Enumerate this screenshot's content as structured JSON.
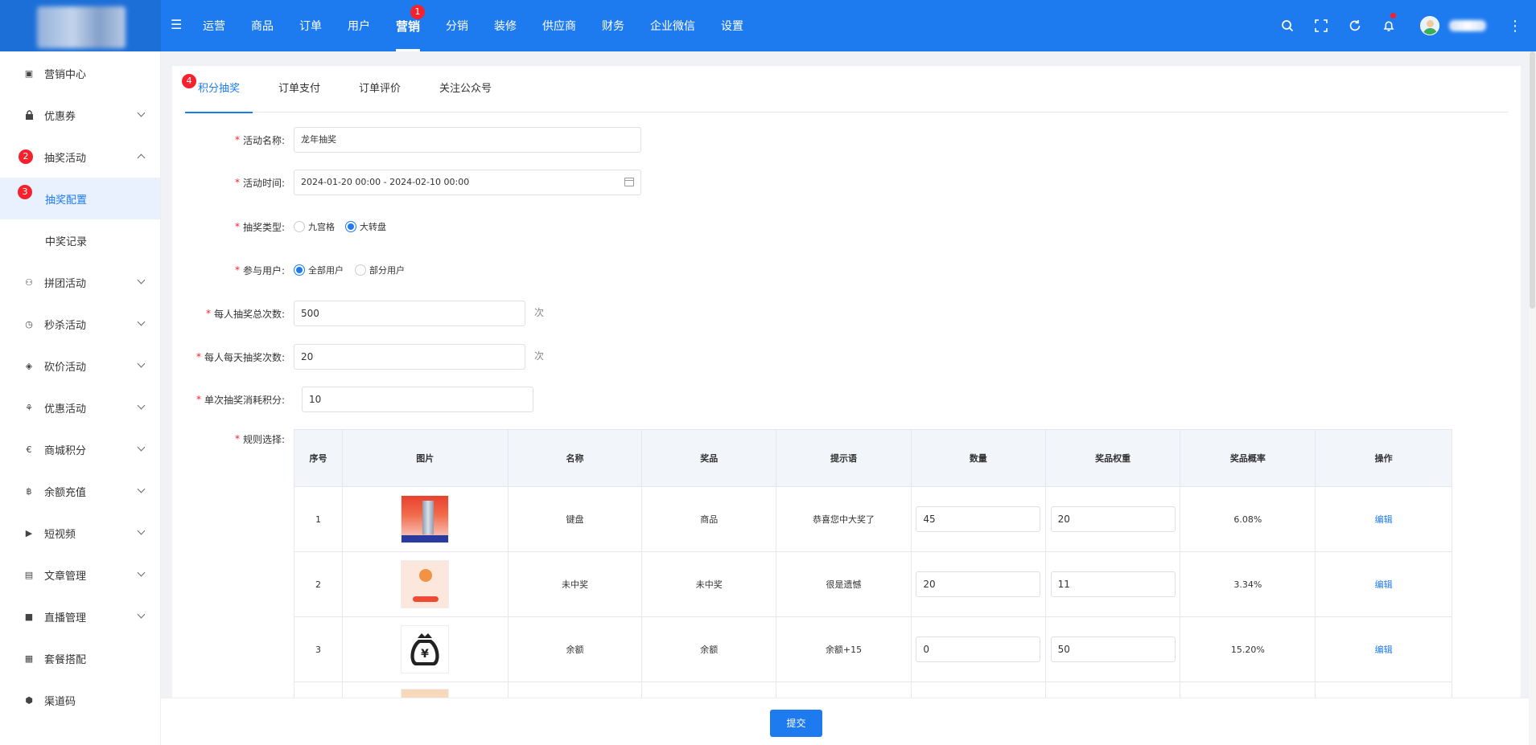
{
  "header": {
    "nav": [
      "运营",
      "商品",
      "订单",
      "用户",
      "营销",
      "分销",
      "装修",
      "供应商",
      "财务",
      "企业微信",
      "设置"
    ],
    "active_nav_badge": "1"
  },
  "sidebar": {
    "items": [
      {
        "label": "营销中心",
        "icon": "marketing-center-icon",
        "glyph": "▣"
      },
      {
        "label": "优惠券",
        "icon": "lock-icon",
        "glyph": "🔒"
      },
      {
        "label": "抽奖活动",
        "icon": "lottery-icon",
        "glyph": "◉",
        "badge": "2"
      },
      {
        "label": "拼团活动",
        "icon": "group-buy-icon",
        "glyph": "⚇"
      },
      {
        "label": "秒杀活动",
        "icon": "clock-icon",
        "glyph": "◷"
      },
      {
        "label": "砍价活动",
        "icon": "tag-icon",
        "glyph": "◈"
      },
      {
        "label": "优惠活动",
        "icon": "discount-icon",
        "glyph": "⚘"
      },
      {
        "label": "商城积分",
        "icon": "euro-icon",
        "glyph": "€"
      },
      {
        "label": "余额充值",
        "icon": "bitcoin-icon",
        "glyph": "฿"
      },
      {
        "label": "短视频",
        "icon": "video-icon",
        "glyph": "▶"
      },
      {
        "label": "文章管理",
        "icon": "article-icon",
        "glyph": "▤"
      },
      {
        "label": "直播管理",
        "icon": "camera-icon",
        "glyph": "■"
      },
      {
        "label": "套餐搭配",
        "icon": "package-icon",
        "glyph": "▦"
      },
      {
        "label": "渠道码",
        "icon": "cube-icon",
        "glyph": "⬢"
      }
    ],
    "sub": [
      {
        "label": "抽奖配置",
        "badge": "3"
      },
      {
        "label": "中奖记录"
      }
    ]
  },
  "tabs": {
    "items": [
      "积分抽奖",
      "订单支付",
      "订单评价",
      "关注公众号"
    ],
    "badge": "4"
  },
  "form": {
    "name_label": "活动名称:",
    "name_value": "龙年抽奖",
    "time_label": "活动时间:",
    "time_value": "2024-01-20 00:00 - 2024-02-10 00:00",
    "type_label": "抽奖类型:",
    "type_opt1": "九宫格",
    "type_opt2": "大转盘",
    "users_label": "参与用户:",
    "users_opt1": "全部用户",
    "users_opt2": "部分用户",
    "total_label": "每人抽奖总次数:",
    "total_value": "500",
    "total_unit": "次",
    "daily_label": "每人每天抽奖次数:",
    "daily_value": "20",
    "daily_unit": "次",
    "cost_label": "单次抽奖消耗积分:",
    "cost_value": "10",
    "rules_label": "规则选择:"
  },
  "table": {
    "headers": [
      "序号",
      "图片",
      "名称",
      "奖品",
      "提示语",
      "数量",
      "奖品权重",
      "奖品概率",
      "操作"
    ],
    "rows": [
      {
        "no": "1",
        "name": "键盘",
        "prize": "商品",
        "tip": "恭喜您中大奖了",
        "qty": "45",
        "weight": "20",
        "prob": "6.08%",
        "op": "编辑"
      },
      {
        "no": "2",
        "name": "未中奖",
        "prize": "未中奖",
        "tip": "很是遗憾",
        "qty": "20",
        "weight": "11",
        "prob": "3.34%",
        "op": "编辑"
      },
      {
        "no": "3",
        "name": "余额",
        "prize": "余额",
        "tip": "余额+15",
        "qty": "0",
        "weight": "50",
        "prob": "15.20%",
        "op": "编辑"
      }
    ]
  },
  "footer": {
    "submit": "提交"
  },
  "colors": {
    "primary": "#1e7bef",
    "badge": "#f5222d"
  }
}
